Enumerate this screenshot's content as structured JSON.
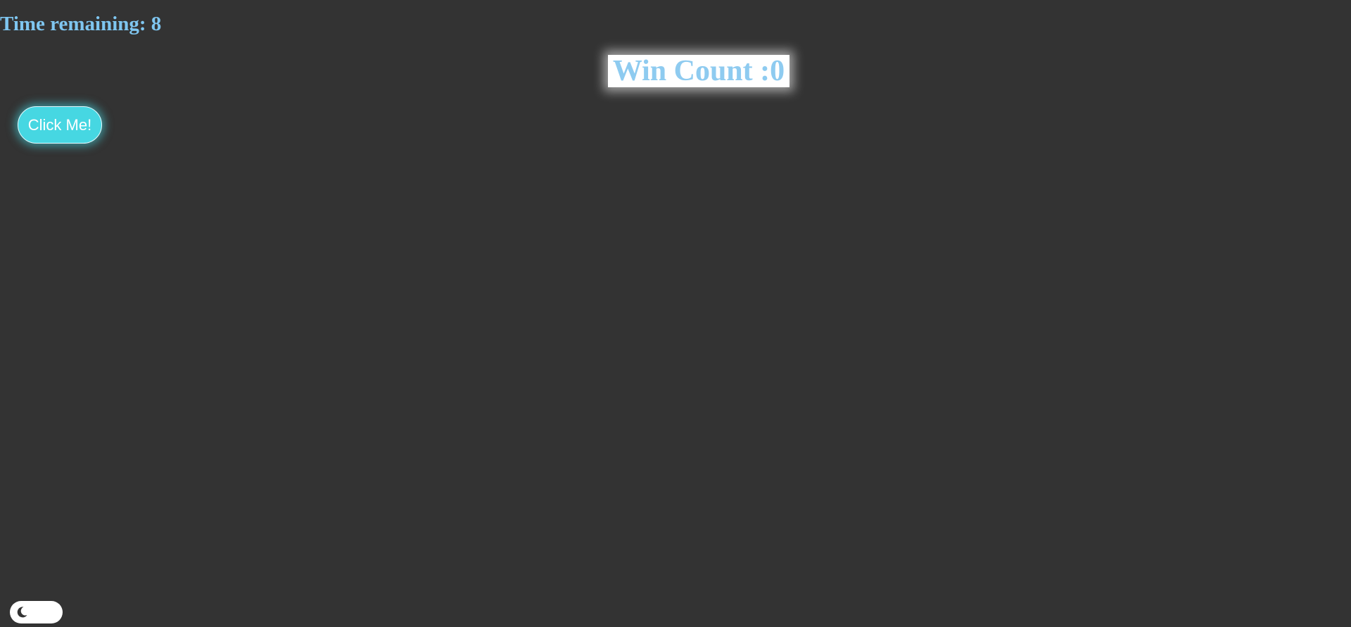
{
  "timer": {
    "label": "Time remaining: 8"
  },
  "score": {
    "label": "Win Count :0"
  },
  "game": {
    "click_button_label": "Click Me!"
  },
  "theme_toggle": {
    "icon": "moon-icon"
  },
  "colors": {
    "background": "#333333",
    "text_accent": "#7fc6f0",
    "button": "#46d7e2",
    "score_box": "#ffffff"
  }
}
